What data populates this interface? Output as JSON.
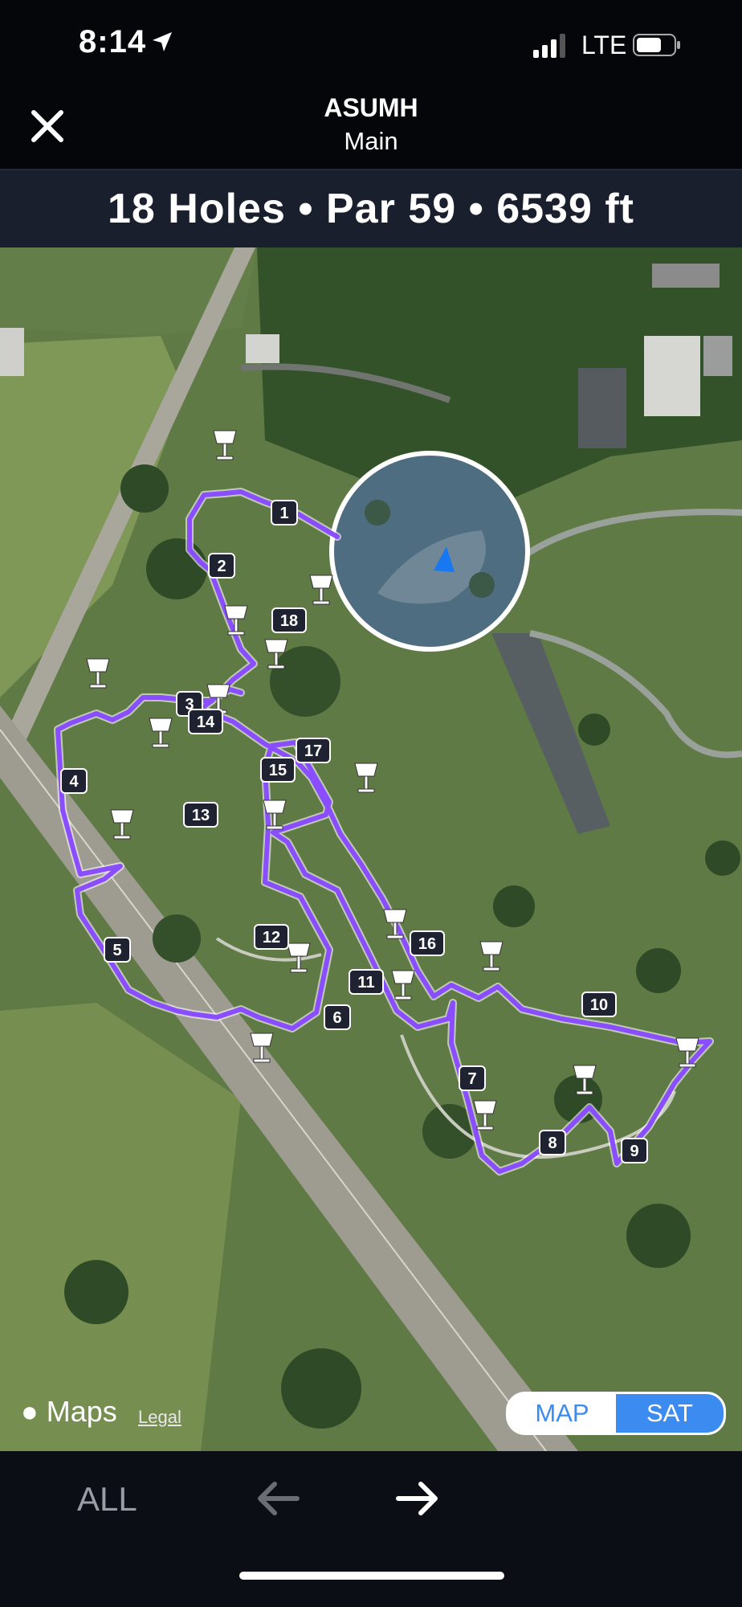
{
  "status_bar": {
    "time": "8:14",
    "carrier": "LTE"
  },
  "header": {
    "title": "ASUMH",
    "subtitle": "Main",
    "close_icon": "close-icon"
  },
  "stats": {
    "summary": "18 Holes • Par 59 • 6539 ft"
  },
  "map": {
    "provider_label": "Maps",
    "legal_label": "Legal",
    "toggle": {
      "map_label": "MAP",
      "sat_label": "SAT",
      "selected": "SAT"
    },
    "route_color": "#8a4dff",
    "hole_labels": [
      "1",
      "2",
      "3",
      "4",
      "5",
      "6",
      "7",
      "8",
      "9",
      "10",
      "11",
      "12",
      "13",
      "14",
      "15",
      "16",
      "17",
      "18"
    ]
  },
  "bottom_nav": {
    "all_label": "ALL",
    "prev_icon": "arrow-left-icon",
    "next_icon": "arrow-right-icon"
  },
  "colors": {
    "accent": "#3b8bf0",
    "route": "#8a4dff",
    "background": "#05060a"
  }
}
